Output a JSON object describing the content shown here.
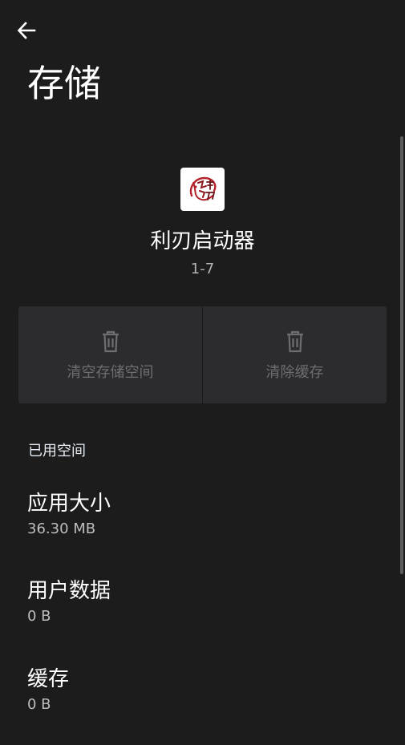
{
  "header": {
    "title": "存储",
    "back_icon": "arrow-back-icon"
  },
  "app": {
    "name": "利刃启动器",
    "version": "1-7",
    "icon": "app-logo-icon"
  },
  "actions": [
    {
      "label": "清空存储空间",
      "icon": "trash-icon"
    },
    {
      "label": "清除缓存",
      "icon": "trash-icon"
    }
  ],
  "section": {
    "title": "已用空间"
  },
  "items": [
    {
      "title": "应用大小",
      "value": "36.30 MB"
    },
    {
      "title": "用户数据",
      "value": "0 B"
    },
    {
      "title": "缓存",
      "value": "0 B"
    }
  ],
  "colors": {
    "background": "#1c1c1c",
    "card": "#2c2c2e",
    "disabled_text": "#6e6e70",
    "logo_red": "#b5232a"
  }
}
